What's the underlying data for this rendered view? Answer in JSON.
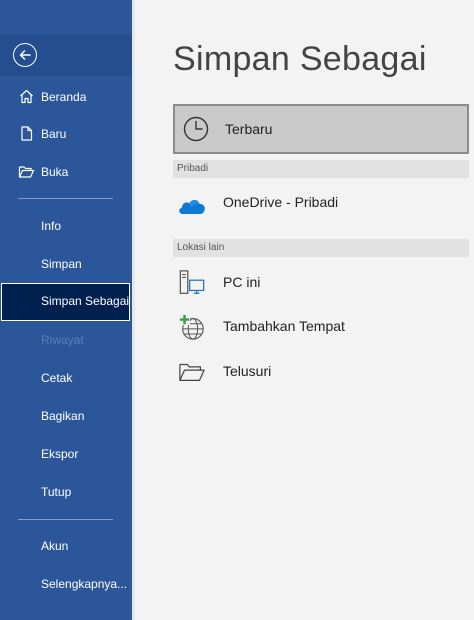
{
  "sidebar": {
    "back_icon": "back-arrow-icon",
    "items": [
      {
        "label": "Beranda",
        "icon": "home-icon"
      },
      {
        "label": "Baru",
        "icon": "new-document-icon"
      },
      {
        "label": "Buka",
        "icon": "open-folder-icon"
      },
      {
        "label": "Info"
      },
      {
        "label": "Simpan"
      },
      {
        "label": "Simpan Sebagai",
        "selected": true
      },
      {
        "label": "Riwayat",
        "disabled": true
      },
      {
        "label": "Cetak"
      },
      {
        "label": "Bagikan"
      },
      {
        "label": "Ekspor"
      },
      {
        "label": "Tutup"
      },
      {
        "label": "Akun"
      },
      {
        "label": "Selengkapnya..."
      }
    ]
  },
  "main": {
    "title": "Simpan Sebagai",
    "recent": {
      "label": "Terbaru",
      "icon": "clock-icon"
    },
    "sections": [
      {
        "header": "Pribadi",
        "items": [
          {
            "label": "OneDrive - Pribadi",
            "icon": "onedrive-cloud-icon"
          }
        ]
      },
      {
        "header": "Lokasi lain",
        "items": [
          {
            "label": "PC ini",
            "icon": "pc-icon"
          },
          {
            "label": "Tambahkan Tempat",
            "icon": "add-place-globe-icon"
          },
          {
            "label": "Telusuri",
            "icon": "browse-folder-icon"
          }
        ]
      }
    ]
  },
  "colors": {
    "sidebar_bg": "#2b579a",
    "selected_bg": "#002050",
    "main_bg": "#f3f3f3",
    "recent_bg": "#c9c9c9",
    "onedrive": "#0f78d4"
  }
}
